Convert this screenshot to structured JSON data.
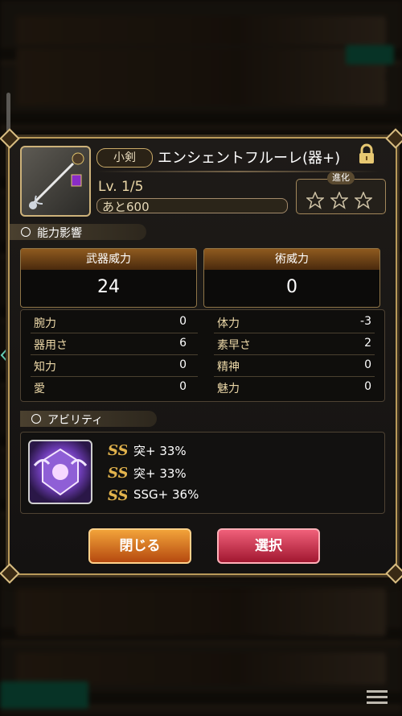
{
  "weapon": {
    "type": "小剣",
    "name": "エンシェントフルーレ(器+)",
    "level": "Lv. 1/5",
    "remaining": "あと600",
    "evolution_label": "進化",
    "evolution_stars": 3,
    "locked": true
  },
  "sections": {
    "stats_title": "能力影響",
    "ability_title": "アビリティ"
  },
  "power": {
    "weapon_label": "武器威力",
    "weapon_value": "24",
    "magic_label": "術威力",
    "magic_value": "0"
  },
  "stats": {
    "left": [
      {
        "label": "腕力",
        "value": "0"
      },
      {
        "label": "器用さ",
        "value": "6"
      },
      {
        "label": "知力",
        "value": "0"
      },
      {
        "label": "愛",
        "value": "0"
      }
    ],
    "right": [
      {
        "label": "体力",
        "value": "-3"
      },
      {
        "label": "素早さ",
        "value": "2"
      },
      {
        "label": "精神",
        "value": "0"
      },
      {
        "label": "魅力",
        "value": "0"
      }
    ]
  },
  "abilities": [
    {
      "text": "突+ 33%"
    },
    {
      "text": "突+ 33%"
    },
    {
      "text": "SSG+ 36%"
    }
  ],
  "buttons": {
    "close": "閉じる",
    "select": "選択"
  },
  "colors": {
    "frame_gold": "#b99a5a",
    "close_button": "#e0862a",
    "select_button": "#d0334f"
  }
}
